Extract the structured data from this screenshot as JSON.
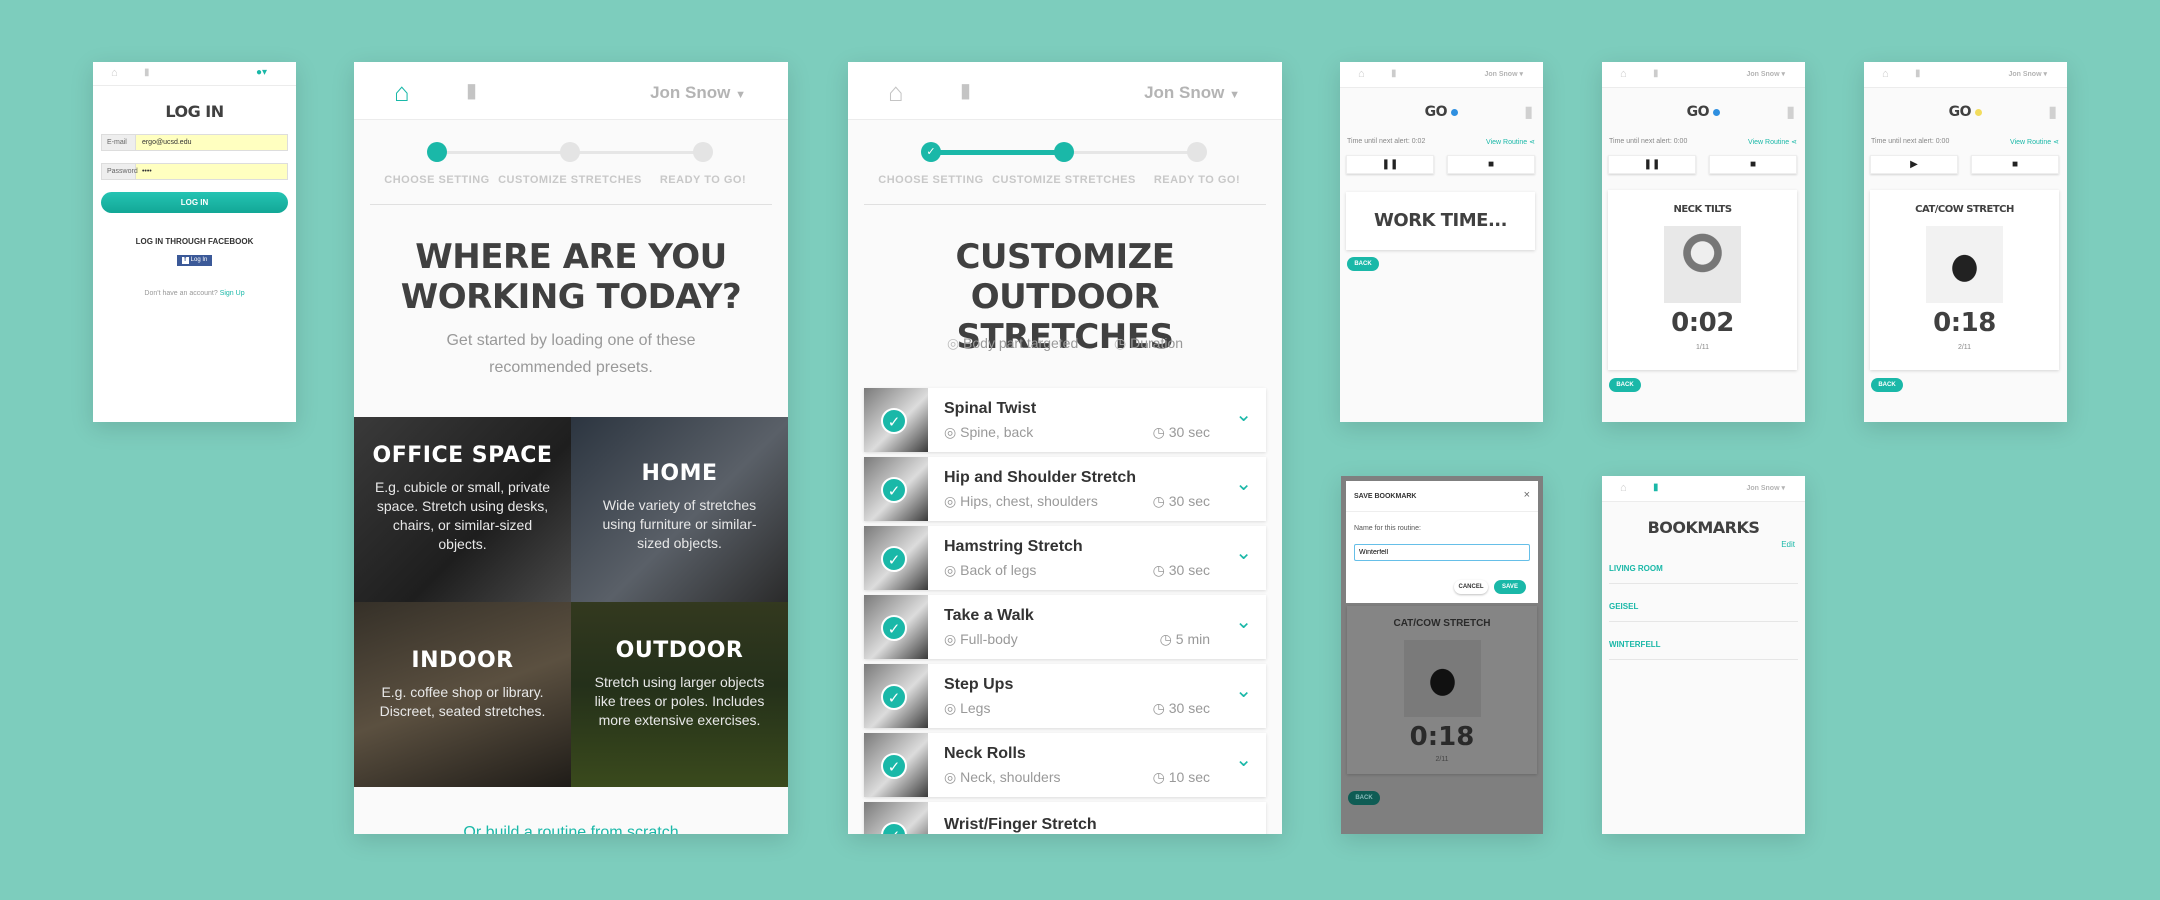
{
  "colors": {
    "background": "#7dcdbd",
    "accent": "#1ab8a8",
    "input_fill": "#ffffc0",
    "facebook": "#3b5998",
    "go_dot_blue": "#2f8fe0",
    "go_dot_yellow": "#f2dc5d"
  },
  "login": {
    "title": "LOG IN",
    "email_label": "E-mail",
    "email_value": "ergo@ucsd.edu",
    "password_label": "Password",
    "password_value": "••••",
    "login_button": "LOG IN",
    "facebook_heading": "LOG IN THROUGH FACEBOOK",
    "facebook_button": "Log In",
    "no_account": "Don't have an account?",
    "signup_link": "Sign Up",
    "icons": [
      "home-icon",
      "bookmark-icon",
      "user-icon"
    ]
  },
  "setting": {
    "user": "Jon Snow",
    "steps": [
      "CHOOSE SETTING",
      "CUSTOMIZE STRETCHES",
      "READY TO GO!"
    ],
    "title": "WHERE ARE YOU WORKING TODAY?",
    "subtitle": "Get started by loading one of these recommended presets.",
    "tiles": [
      {
        "title": "OFFICE SPACE",
        "desc": "E.g. cubicle or small, private space. Stretch using desks, chairs, or similar-sized objects."
      },
      {
        "title": "HOME",
        "desc": "Wide variety of stretches using furniture or similar-sized objects."
      },
      {
        "title": "INDOOR",
        "desc": "E.g. coffee shop or library. Discreet, seated stretches."
      },
      {
        "title": "OUTDOOR",
        "desc": "Stretch using larger objects like trees or poles. Includes more extensive exercises."
      }
    ],
    "footer": "Or build a routine from scratch"
  },
  "customize": {
    "user": "Jon Snow",
    "steps": [
      "CHOOSE SETTING",
      "CUSTOMIZE STRETCHES",
      "READY TO GO!"
    ],
    "title": "CUSTOMIZE OUTDOOR STRETCHES",
    "legend_part": "Body part targeted",
    "legend_duration": "Duration",
    "stretches": [
      {
        "name": "Spinal Twist",
        "part": "Spine, back",
        "duration": "30 sec"
      },
      {
        "name": "Hip and Shoulder Stretch",
        "part": "Hips, chest, shoulders",
        "duration": "30 sec"
      },
      {
        "name": "Hamstring Stretch",
        "part": "Back of legs",
        "duration": "30 sec"
      },
      {
        "name": "Take a Walk",
        "part": "Full-body",
        "duration": "5 min"
      },
      {
        "name": "Step Ups",
        "part": "Legs",
        "duration": "30 sec"
      },
      {
        "name": "Neck Rolls",
        "part": "Neck, shoulders",
        "duration": "10 sec"
      },
      {
        "name": "Wrist/Finger Stretch",
        "part": "",
        "duration": ""
      }
    ]
  },
  "go_worktime": {
    "user": "Jon Snow",
    "title": "GO",
    "alert": "Time until next alert: 0:02",
    "view_routine": "View Routine",
    "pause": "❚❚",
    "stop": "■",
    "message": "WORK TIME...",
    "back": "BACK"
  },
  "go_neck": {
    "user": "Jon Snow",
    "title": "GO",
    "alert": "Time until next alert: 0:00",
    "view_routine": "View Routine",
    "pause": "❚❚",
    "stop": "■",
    "exercise": "NECK TILTS",
    "timer": "0:02",
    "progress": "1/11",
    "back": "BACK"
  },
  "go_catcow": {
    "user": "Jon Snow",
    "title": "GO",
    "alert": "Time until next alert: 0:00",
    "view_routine": "View Routine",
    "play": "▶",
    "stop": "■",
    "exercise": "CAT/COW STRETCH",
    "timer": "0:18",
    "progress": "2/11",
    "back": "BACK"
  },
  "save_bookmark": {
    "title": "SAVE BOOKMARK",
    "close": "×",
    "label": "Name for this routine:",
    "value": "Winterfell",
    "cancel": "CANCEL",
    "save": "SAVE",
    "exercise": "CAT/COW STRETCH",
    "timer": "0:18",
    "progress": "2/11",
    "back": "BACK"
  },
  "bookmarks": {
    "user": "Jon Snow",
    "title": "BOOKMARKS",
    "edit": "Edit",
    "items": [
      "LIVING ROOM",
      "GEISEL",
      "WINTERFELL"
    ]
  }
}
